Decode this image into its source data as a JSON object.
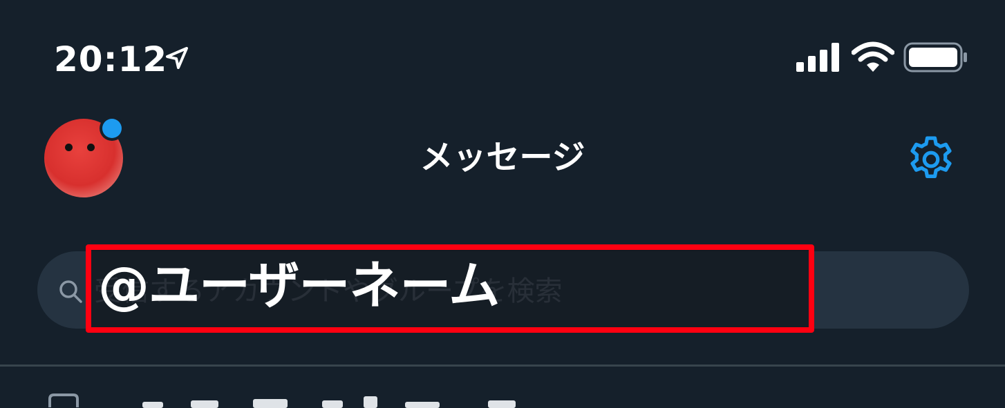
{
  "status_bar": {
    "time": "20:12",
    "icons": [
      "location-arrow-icon",
      "cellular-signal-icon",
      "wifi-icon",
      "battery-icon"
    ]
  },
  "header": {
    "title": "メッセージ",
    "avatar_icon": "avatar",
    "settings_icon": "gear-icon"
  },
  "search": {
    "placeholder": "受信するアカウントやグループを検索",
    "icon": "search-icon"
  },
  "annotation": {
    "text": "@ユーザーネーム",
    "highlight_color": "#ff0011"
  },
  "colors": {
    "background": "#15202b",
    "accent": "#1d9bf0",
    "search_background": "#253341",
    "muted_text": "#8b98a5"
  }
}
